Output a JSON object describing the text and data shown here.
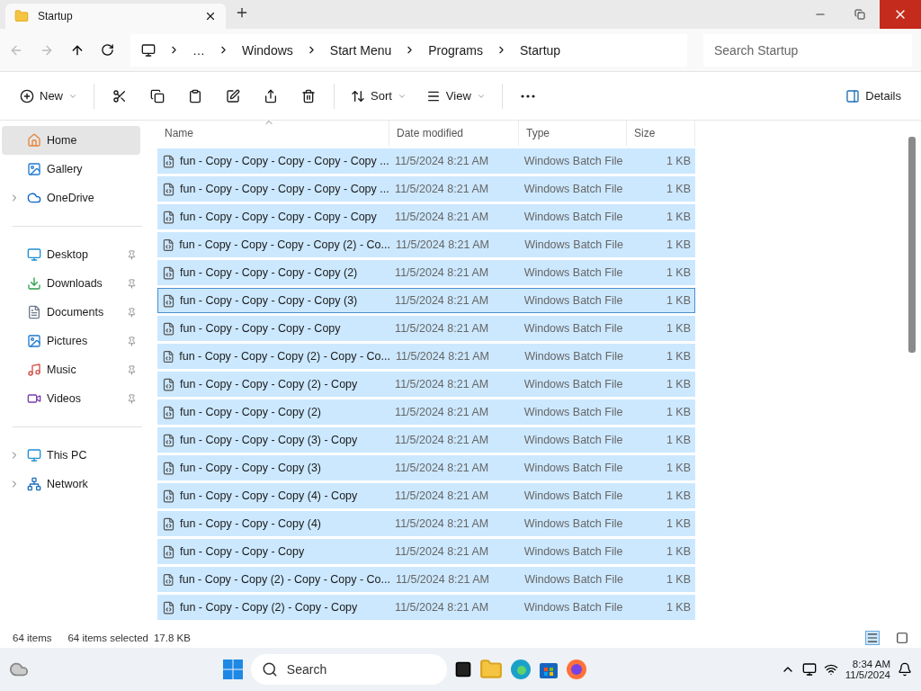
{
  "window": {
    "tab_title": "Startup"
  },
  "breadcrumbs": [
    "…",
    "Windows",
    "Start Menu",
    "Programs",
    "Startup"
  ],
  "search": {
    "placeholder": "Search Startup"
  },
  "commands": [
    {
      "kind": "new",
      "label": "New"
    },
    {
      "kind": "cut"
    },
    {
      "kind": "copy"
    },
    {
      "kind": "paste"
    },
    {
      "kind": "rename"
    },
    {
      "kind": "share"
    },
    {
      "kind": "delete"
    },
    {
      "kind": "sort",
      "label": "Sort"
    },
    {
      "kind": "view",
      "label": "View"
    },
    {
      "kind": "more"
    }
  ],
  "details_button": "Details",
  "sidebar": {
    "items": [
      {
        "kind": "home",
        "label": "Home",
        "selected": true
      },
      {
        "kind": "gallery",
        "label": "Gallery",
        "selected": false
      },
      {
        "kind": "onedrive",
        "label": "OneDrive",
        "selected": false,
        "expandable": true
      },
      {
        "kind": "divider"
      },
      {
        "kind": "desktop",
        "label": "Desktop",
        "selected": false,
        "pinned": true
      },
      {
        "kind": "downloads",
        "label": "Downloads",
        "selected": false,
        "pinned": true
      },
      {
        "kind": "documents",
        "label": "Documents",
        "selected": false,
        "pinned": true
      },
      {
        "kind": "pictures",
        "label": "Pictures",
        "selected": false,
        "pinned": true
      },
      {
        "kind": "music",
        "label": "Music",
        "selected": false,
        "pinned": true
      },
      {
        "kind": "videos",
        "label": "Videos",
        "selected": false,
        "pinned": true
      },
      {
        "kind": "divider"
      },
      {
        "kind": "pc",
        "label": "This PC",
        "selected": false,
        "expandable": true
      },
      {
        "kind": "network",
        "label": "Network",
        "selected": false,
        "expandable": true
      }
    ]
  },
  "table": {
    "columns": [
      "Name",
      "Date modified",
      "Type",
      "Size"
    ],
    "rows": [
      {
        "name": "fun - Copy - Copy - Copy - Copy - Copy ...",
        "date": "11/5/2024 8:21 AM",
        "type": "Windows Batch File",
        "size": "1 KB",
        "selected": true,
        "focused": false
      },
      {
        "name": "fun - Copy - Copy - Copy - Copy - Copy ...",
        "date": "11/5/2024 8:21 AM",
        "type": "Windows Batch File",
        "size": "1 KB",
        "selected": true,
        "focused": false
      },
      {
        "name": "fun - Copy - Copy - Copy - Copy - Copy",
        "date": "11/5/2024 8:21 AM",
        "type": "Windows Batch File",
        "size": "1 KB",
        "selected": true,
        "focused": false
      },
      {
        "name": "fun - Copy - Copy - Copy - Copy (2) - Co...",
        "date": "11/5/2024 8:21 AM",
        "type": "Windows Batch File",
        "size": "1 KB",
        "selected": true,
        "focused": false
      },
      {
        "name": "fun - Copy - Copy - Copy - Copy (2)",
        "date": "11/5/2024 8:21 AM",
        "type": "Windows Batch File",
        "size": "1 KB",
        "selected": true,
        "focused": false
      },
      {
        "name": "fun - Copy - Copy - Copy - Copy (3)",
        "date": "11/5/2024 8:21 AM",
        "type": "Windows Batch File",
        "size": "1 KB",
        "selected": true,
        "focused": true
      },
      {
        "name": "fun - Copy - Copy - Copy - Copy",
        "date": "11/5/2024 8:21 AM",
        "type": "Windows Batch File",
        "size": "1 KB",
        "selected": true,
        "focused": false
      },
      {
        "name": "fun - Copy - Copy - Copy (2) - Copy - Co...",
        "date": "11/5/2024 8:21 AM",
        "type": "Windows Batch File",
        "size": "1 KB",
        "selected": true,
        "focused": false
      },
      {
        "name": "fun - Copy - Copy - Copy (2) - Copy",
        "date": "11/5/2024 8:21 AM",
        "type": "Windows Batch File",
        "size": "1 KB",
        "selected": true,
        "focused": false
      },
      {
        "name": "fun - Copy - Copy - Copy (2)",
        "date": "11/5/2024 8:21 AM",
        "type": "Windows Batch File",
        "size": "1 KB",
        "selected": true,
        "focused": false
      },
      {
        "name": "fun - Copy - Copy - Copy (3) - Copy",
        "date": "11/5/2024 8:21 AM",
        "type": "Windows Batch File",
        "size": "1 KB",
        "selected": true,
        "focused": false
      },
      {
        "name": "fun - Copy - Copy - Copy (3)",
        "date": "11/5/2024 8:21 AM",
        "type": "Windows Batch File",
        "size": "1 KB",
        "selected": true,
        "focused": false
      },
      {
        "name": "fun - Copy - Copy - Copy (4) - Copy",
        "date": "11/5/2024 8:21 AM",
        "type": "Windows Batch File",
        "size": "1 KB",
        "selected": true,
        "focused": false
      },
      {
        "name": "fun - Copy - Copy - Copy (4)",
        "date": "11/5/2024 8:21 AM",
        "type": "Windows Batch File",
        "size": "1 KB",
        "selected": true,
        "focused": false
      },
      {
        "name": "fun - Copy - Copy - Copy",
        "date": "11/5/2024 8:21 AM",
        "type": "Windows Batch File",
        "size": "1 KB",
        "selected": true,
        "focused": false
      },
      {
        "name": "fun - Copy - Copy (2) - Copy - Copy - Co...",
        "date": "11/5/2024 8:21 AM",
        "type": "Windows Batch File",
        "size": "1 KB",
        "selected": true,
        "focused": false
      },
      {
        "name": "fun - Copy - Copy (2) - Copy - Copy",
        "date": "11/5/2024 8:21 AM",
        "type": "Windows Batch File",
        "size": "1 KB",
        "selected": true,
        "focused": false
      }
    ]
  },
  "status_bar": {
    "item_count": "64 items",
    "selection": "64 items selected",
    "size": "17.8 KB"
  },
  "taskbar": {
    "search_placeholder": "Search",
    "time": "8:34 AM",
    "date": "11/5/2024"
  }
}
